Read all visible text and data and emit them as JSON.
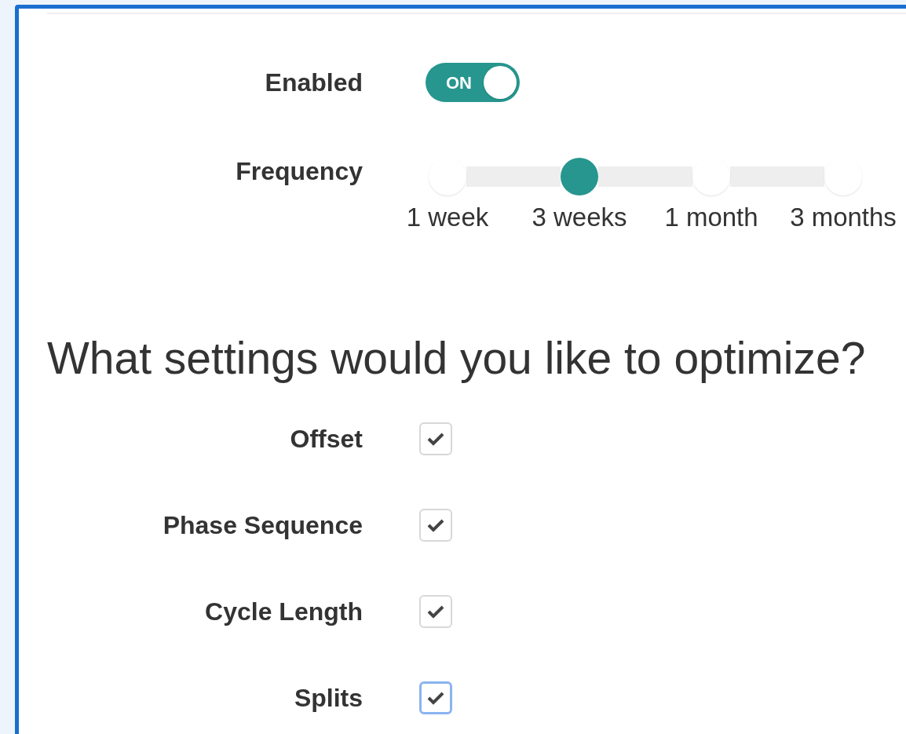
{
  "enabled": {
    "label": "Enabled",
    "on": true,
    "text": "ON"
  },
  "frequency": {
    "label": "Frequency",
    "stops": [
      {
        "label": "1 week",
        "selected": false
      },
      {
        "label": "3 weeks",
        "selected": true
      },
      {
        "label": "1 month",
        "selected": false
      },
      {
        "label": "3 months",
        "selected": false
      }
    ]
  },
  "heading": "What settings would you like to optimize?",
  "options": [
    {
      "label": "Offset",
      "checked": true,
      "focused": false
    },
    {
      "label": "Phase Sequence",
      "checked": true,
      "focused": false
    },
    {
      "label": "Cycle Length",
      "checked": true,
      "focused": false
    },
    {
      "label": "Splits",
      "checked": true,
      "focused": true
    }
  ]
}
